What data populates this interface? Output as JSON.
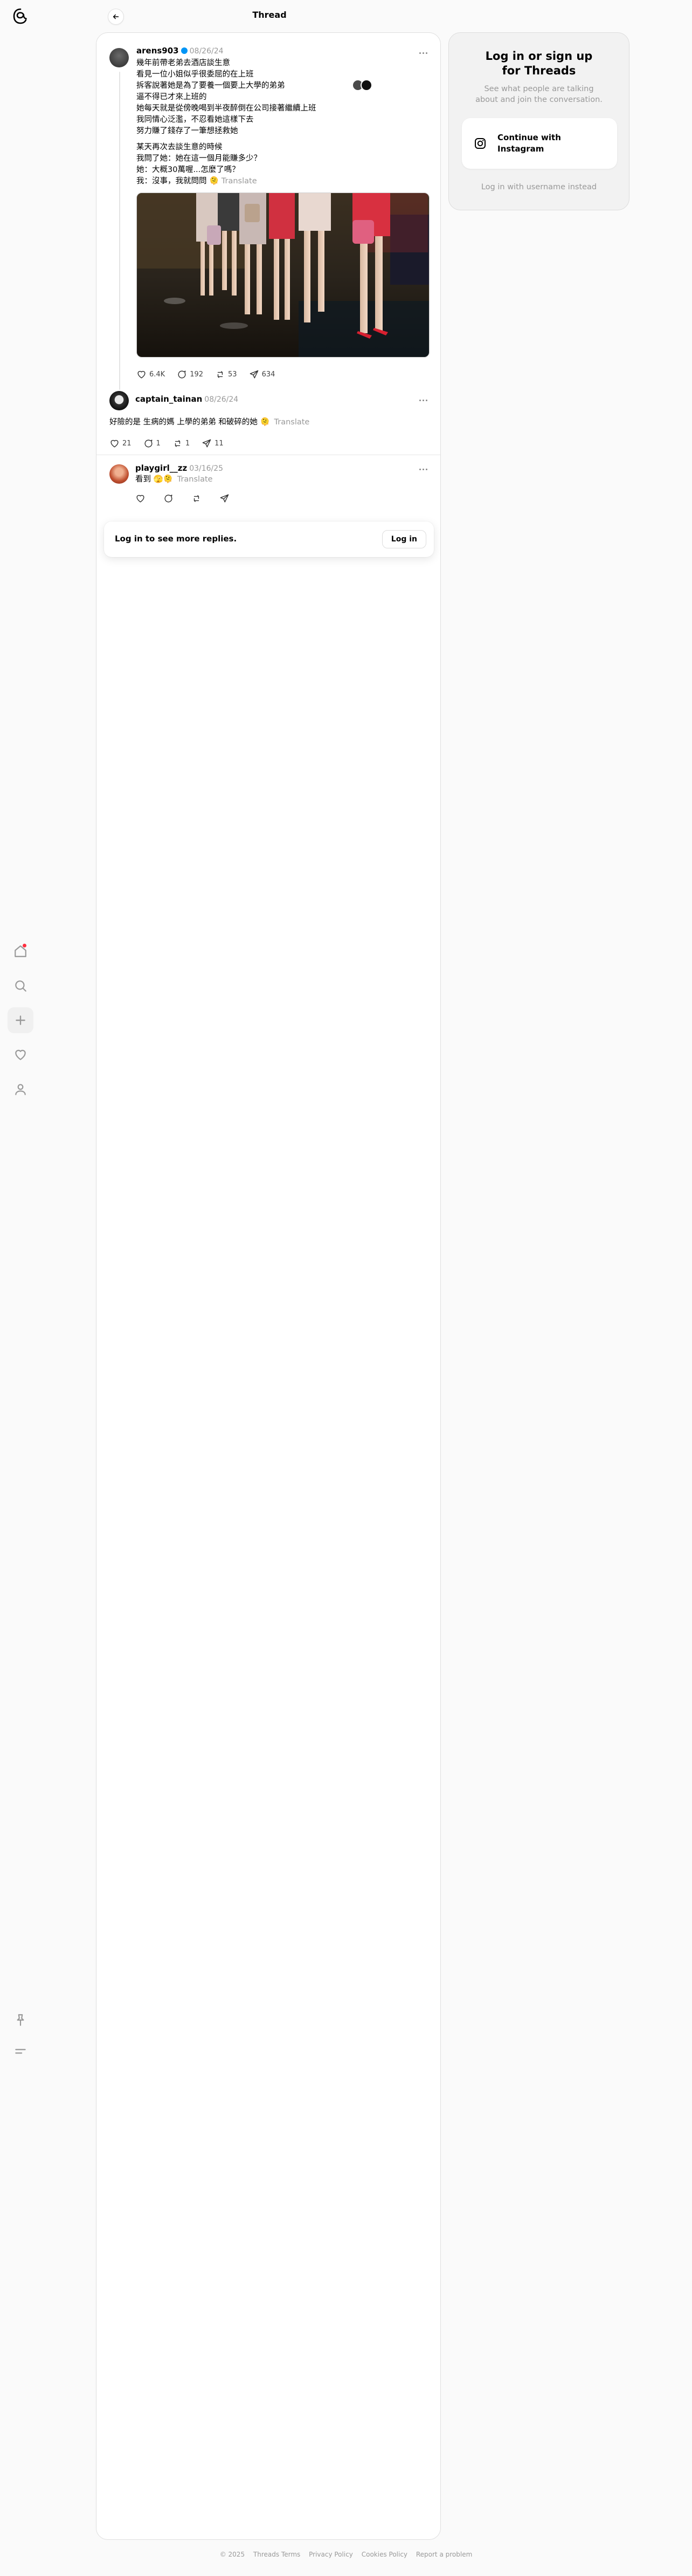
{
  "header": {
    "title": "Thread"
  },
  "nav": {
    "icons": [
      "threads-logo-icon",
      "home-icon",
      "search-icon",
      "plus-icon",
      "heart-icon",
      "user-icon",
      "pin-icon",
      "menu-icon"
    ],
    "notification_color": "#ff3040"
  },
  "posts": [
    {
      "username": "arens903",
      "verified": true,
      "date": "08/26/24",
      "text": "幾年前帶老弟去酒店談生意\n看見一位小姐似乎很委屈的在上班\n拆客說著她是為了要養一個要上大學的弟弟\n逼不得已才來上班的\n她每天就是從傍晚喝到半夜醉倒在公司接著繼續上班\n我同情心泛濫，不忍看她這樣下去\n努力賺了錢存了一筆想拯救她",
      "text2": "某天再次去談生意的時候\n我問了她：她在這一個月能賺多少？\n她：大概30萬喔...怎麼了嗎？\n我：沒事，我就問問",
      "translate": "Translate",
      "likes": "6.4K",
      "replies": "192",
      "reposts": "53",
      "shares": "634"
    },
    {
      "username": "captain_tainan",
      "date": "08/26/24",
      "text": "好險的是 生病的媽 上學的弟弟 和破碎的她 ",
      "translate": "Translate",
      "likes": "21",
      "replies": "1",
      "reposts": "1",
      "shares": "11"
    },
    {
      "username": "playgirl__zz",
      "date": "03/16/25",
      "text": "看到 ",
      "translate": "Translate"
    }
  ],
  "login_prompt": {
    "text": "Log in to see more replies.",
    "button": "Log in"
  },
  "sidebar": {
    "title": "Log in or sign up for Threads",
    "subtitle": "See what people are talking about and join the conversation.",
    "instagram_button": "Continue with Instagram",
    "alt_login": "Log in with username instead"
  },
  "footer": [
    "© 2025",
    "Threads Terms",
    "Privacy Policy",
    "Cookies Policy",
    "Report a problem"
  ]
}
